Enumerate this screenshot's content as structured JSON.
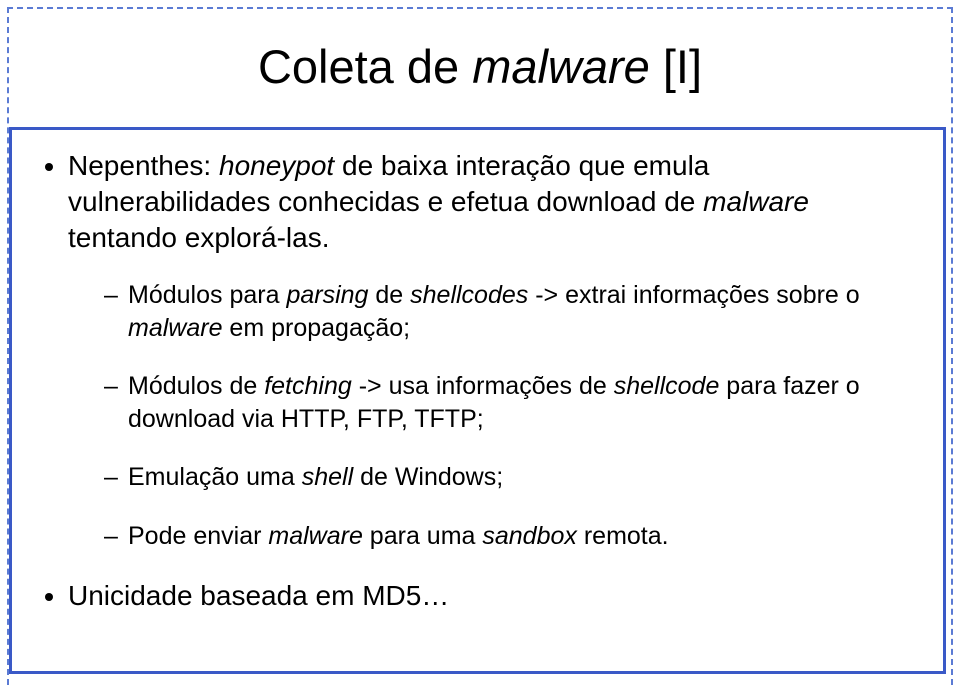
{
  "title": {
    "prefix": "Coleta de ",
    "italic": "malware",
    "suffix": " [I]"
  },
  "bullets": {
    "main1": {
      "pre": "Nepenthes: ",
      "i1": "honeypot",
      "mid1": " de baixa interação que emula vulnerabilidades conhecidas e efetua download de ",
      "i2": "malware",
      "mid2": " tentando explorá-las."
    },
    "sub1": {
      "pre": "Módulos para ",
      "i1": "parsing",
      "mid1": " de ",
      "i2": "shellcodes",
      "mid2": " -> extrai informações sobre o ",
      "i3": "malware",
      "mid3": " em propagação;"
    },
    "sub2": {
      "pre": "Módulos de ",
      "i1": "fetching",
      "mid1": " -> usa informações de ",
      "i2": "shellcode",
      "mid2": " para fazer o download via HTTP, FTP, TFTP;"
    },
    "sub3": {
      "pre": "Emulação uma ",
      "i1": "shell",
      "mid1": " de Windows;"
    },
    "sub4": {
      "pre": "Pode enviar ",
      "i1": "malware",
      "mid1": " para uma ",
      "i2": "sandbox",
      "mid2": " remota."
    },
    "main2": "Unicidade baseada em MD5…"
  }
}
